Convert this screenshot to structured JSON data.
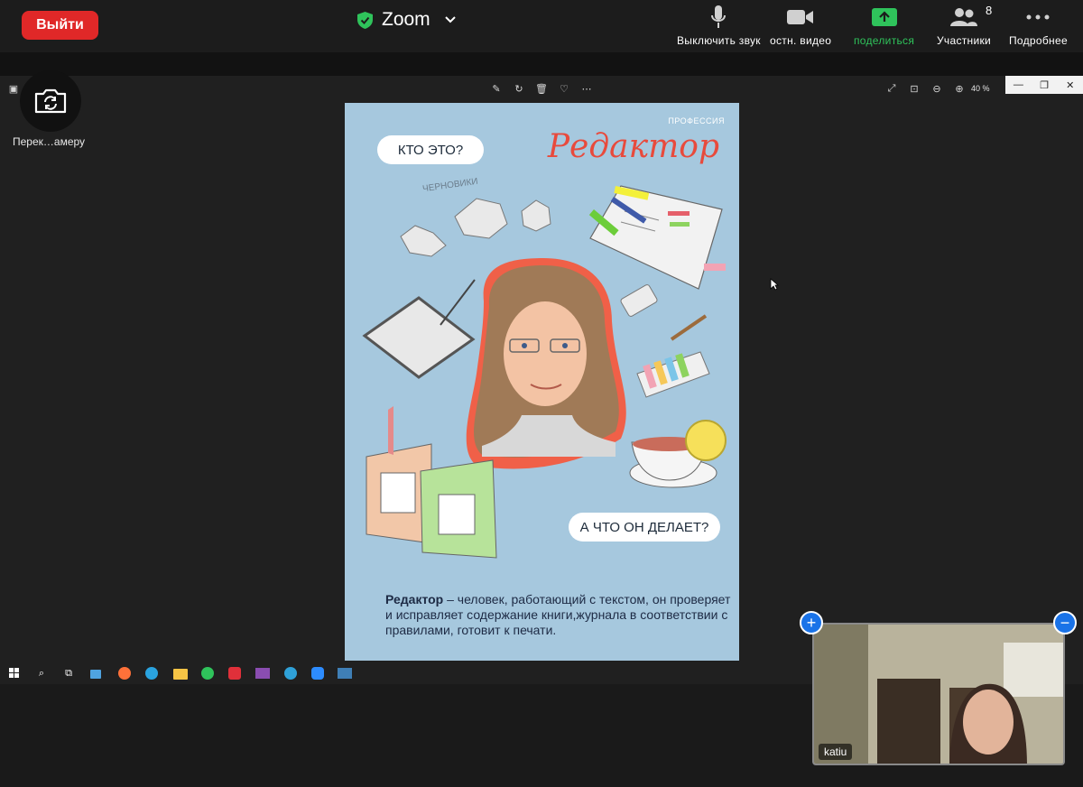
{
  "topbar": {
    "leave_label": "Выйти",
    "app_title": "Zoom",
    "mute_label": "Выключить звук",
    "video_label": "остн. видео",
    "share_label": "поделиться",
    "participants_label": "Участники",
    "participants_count": "8",
    "more_label": "Подробнее"
  },
  "viewer": {
    "zoom_level": "40 %",
    "camera_label": "Перек…амеру"
  },
  "poster": {
    "profession_label": "ПРОФЕССИЯ",
    "title": "Редактор",
    "question1": "КТО ЭТО?",
    "question2": "А ЧТО ОН ДЕЛАЕТ?",
    "drafts_label": "ЧЕРНОВИКИ",
    "description_bold": "Редактор",
    "description_rest": " – человек, работающий с текстом, он проверяет и исправляет содержание книги,журнала в соответствии с правилами, готовит к печати."
  },
  "video": {
    "participant_name": "katiu"
  },
  "colors": {
    "leave": "#e02828",
    "share": "#2fc35b",
    "poster_bg": "#a6c8de",
    "title_red": "#e84a3c",
    "accent_blue": "#1a73e8"
  }
}
